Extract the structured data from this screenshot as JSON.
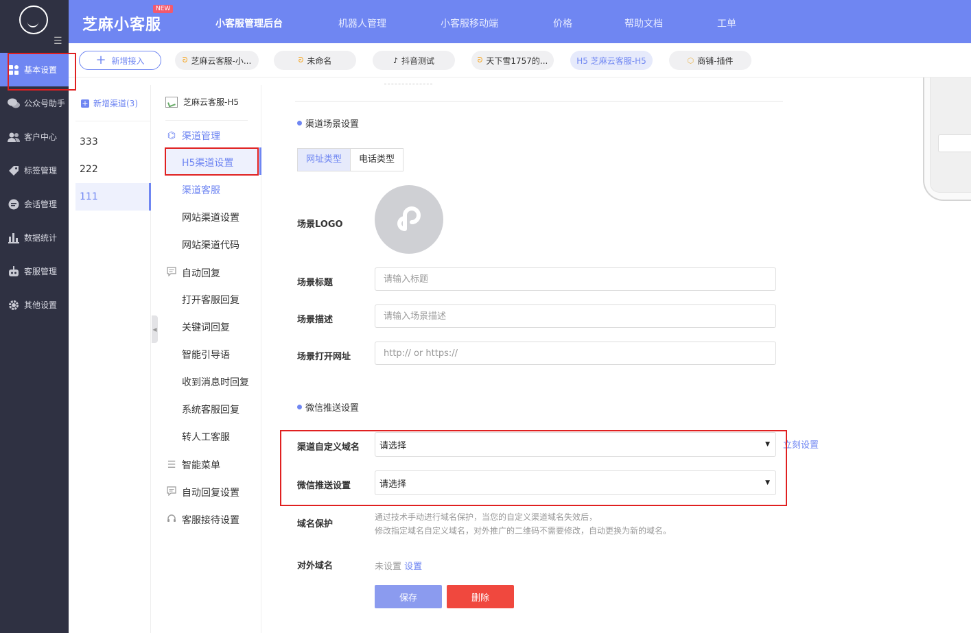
{
  "sidebar": {
    "items": [
      {
        "label": "基本设置",
        "icon": "grid-icon"
      },
      {
        "label": "公众号助手",
        "icon": "wechat-icon"
      },
      {
        "label": "客户中心",
        "icon": "users-icon"
      },
      {
        "label": "标签管理",
        "icon": "tag-icon"
      },
      {
        "label": "会话管理",
        "icon": "chat-icon"
      },
      {
        "label": "数据统计",
        "icon": "bar-chart-icon"
      },
      {
        "label": "客服管理",
        "icon": "robot-icon"
      },
      {
        "label": "其他设置",
        "icon": "gear-icon"
      }
    ],
    "active_index": 0
  },
  "header": {
    "brand": "芝麻小客服",
    "badge": "NEW",
    "nav": [
      "小客服管理后台",
      "机器人管理",
      "小客服移动端",
      "价格",
      "帮助文档",
      "工单"
    ],
    "active_nav": 0
  },
  "channel_tabs": {
    "add_label": "新增接入",
    "tabs": [
      {
        "label": "芝麻云客服-小...",
        "icon": "mini-program-icon"
      },
      {
        "label": "未命名",
        "icon": "mini-program-icon"
      },
      {
        "label": "抖音测试",
        "icon": "tiktok-icon"
      },
      {
        "label": "天下雪1757的...",
        "icon": "mini-program-icon"
      },
      {
        "label": "H5 芝麻云客服-H5",
        "icon": ""
      },
      {
        "label": "商铺-插件",
        "icon": "cube-icon"
      }
    ],
    "selected_index": 4
  },
  "channel_list": {
    "add_label": "新增渠道(3)",
    "items": [
      "333",
      "222",
      "111"
    ],
    "selected_index": 2
  },
  "settings_menu": {
    "header": "芝麻云客服-H5",
    "groups": [
      {
        "label": "渠道管理",
        "items": [
          "H5渠道设置",
          "渠道客服",
          "网站渠道设置",
          "网站渠道代码"
        ]
      },
      {
        "label": "自动回复",
        "items": [
          "打开客服回复",
          "关键词回复",
          "智能引导语",
          "收到消息时回复",
          "系统客服回复",
          "转人工客服"
        ]
      },
      {
        "label": "智能菜单",
        "items": []
      },
      {
        "label": "自动回复设置",
        "items": []
      },
      {
        "label": "客服接待设置",
        "items": []
      }
    ],
    "selected": "H5渠道设置"
  },
  "form": {
    "scene_section": "渠道场景设置",
    "type_options": [
      "网址类型",
      "电话类型"
    ],
    "type_selected": 0,
    "logo_label": "场景LOGO",
    "title_label": "场景标题",
    "title_placeholder": "请输入标题",
    "desc_label": "场景描述",
    "desc_placeholder": "请输入场景描述",
    "url_label": "场景打开网址",
    "url_placeholder": "http:// or https://",
    "push_section": "微信推送设置",
    "domain_label": "渠道自定义域名",
    "domain_value": "请选择",
    "domain_link": "立刻设置",
    "push_label": "微信推送设置",
    "push_value": "请选择",
    "protect_label": "域名保护",
    "protect_help_1": "通过技术手动进行域名保护，当您的自定义渠道域名失效后，",
    "protect_help_2": "修改指定域名自定义域名，对外推广的二维码不需要修改，自动更换为新的域名。",
    "external_label": "对外域名",
    "external_value": "未设置",
    "external_link": "设置",
    "save": "保存",
    "delete": "删除"
  },
  "colors": {
    "primary": "#6f86f2",
    "sidebar_bg": "#2f3142",
    "danger": "#f0483e",
    "annotation": "#e02020"
  }
}
